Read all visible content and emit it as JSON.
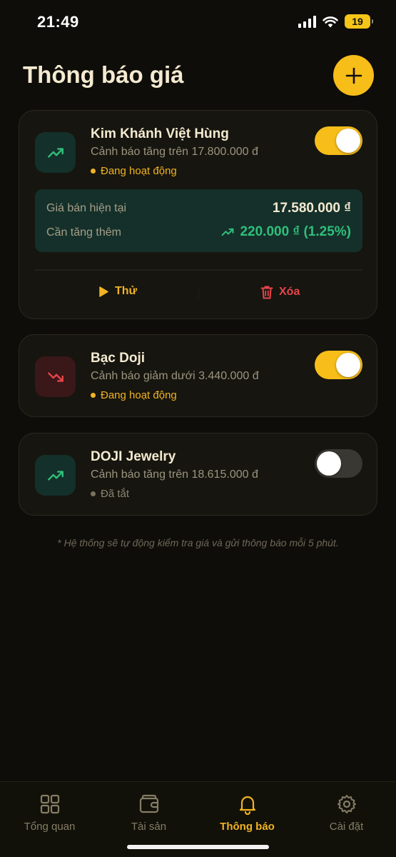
{
  "status_bar": {
    "time": "21:49",
    "battery": "19"
  },
  "header": {
    "title": "Thông báo giá"
  },
  "alerts": [
    {
      "name": "Kim Khánh Việt Hùng",
      "description": "Cảnh báo tăng trên 17.800.000 đ",
      "status": "Đang hoạt động",
      "enabled": true,
      "trend": "up",
      "details": {
        "current_label": "Giá bán hiện tại",
        "current_value": "17.580.000 ₫",
        "needed_label": "Cần tăng thêm",
        "needed_value": "220.000 ₫ (1.25%)"
      },
      "actions": {
        "test": "Thử",
        "delete": "Xóa"
      }
    },
    {
      "name": "Bạc Doji",
      "description": "Cảnh báo giảm dưới 3.440.000 đ",
      "status": "Đang hoạt động",
      "enabled": true,
      "trend": "down"
    },
    {
      "name": "DOJI Jewelry",
      "description": "Cảnh báo tăng trên 18.615.000 đ",
      "status": "Đã tắt",
      "enabled": false,
      "trend": "up"
    }
  ],
  "footnote": "* Hệ thống sẽ tự động kiểm tra giá và gửi thông báo mỗi 5 phút.",
  "nav": [
    {
      "label": "Tổng quan",
      "icon": "grid-icon",
      "active": false
    },
    {
      "label": "Tài sản",
      "icon": "wallet-icon",
      "active": false
    },
    {
      "label": "Thông báo",
      "icon": "bell-icon",
      "active": true
    },
    {
      "label": "Cài đặt",
      "icon": "gear-icon",
      "active": false
    }
  ],
  "colors": {
    "accent": "#f7bd19",
    "positive": "#2fbf7a",
    "negative": "#e5454b",
    "background": "#0e0d0a"
  }
}
